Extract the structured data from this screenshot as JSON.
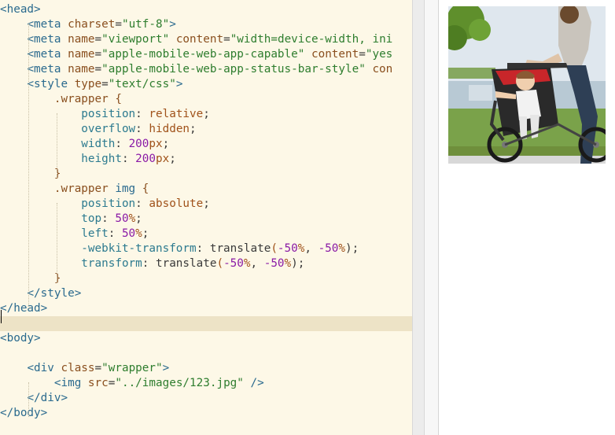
{
  "editor": {
    "lines": [
      [
        [
          "c-tag",
          "<head>"
        ]
      ],
      [
        [
          "c-txt",
          "    "
        ],
        [
          "c-tag",
          "<meta "
        ],
        [
          "c-attr",
          "charset"
        ],
        [
          "c-txt",
          "="
        ],
        [
          "c-val",
          "\"utf-8\""
        ],
        [
          "c-tag",
          ">"
        ]
      ],
      [
        [
          "c-txt",
          "    "
        ],
        [
          "c-tag",
          "<meta "
        ],
        [
          "c-attr",
          "name"
        ],
        [
          "c-txt",
          "="
        ],
        [
          "c-val",
          "\"viewport\""
        ],
        [
          "c-txt",
          " "
        ],
        [
          "c-attr",
          "content"
        ],
        [
          "c-txt",
          "="
        ],
        [
          "c-val",
          "\"width=device-width, ini"
        ]
      ],
      [
        [
          "c-txt",
          "    "
        ],
        [
          "c-tag",
          "<meta "
        ],
        [
          "c-attr",
          "name"
        ],
        [
          "c-txt",
          "="
        ],
        [
          "c-val",
          "\"apple-mobile-web-app-capable\""
        ],
        [
          "c-txt",
          " "
        ],
        [
          "c-attr",
          "content"
        ],
        [
          "c-txt",
          "="
        ],
        [
          "c-val",
          "\"yes"
        ]
      ],
      [
        [
          "c-txt",
          "    "
        ],
        [
          "c-tag",
          "<meta "
        ],
        [
          "c-attr",
          "name"
        ],
        [
          "c-txt",
          "="
        ],
        [
          "c-val",
          "\"apple-mobile-web-app-status-bar-style\""
        ],
        [
          "c-txt",
          " "
        ],
        [
          "c-attr",
          "con"
        ]
      ],
      [
        [
          "c-txt",
          "    "
        ],
        [
          "c-tag",
          "<style "
        ],
        [
          "c-attr",
          "type"
        ],
        [
          "c-txt",
          "="
        ],
        [
          "c-val",
          "\"text/css\""
        ],
        [
          "c-tag",
          ">"
        ]
      ],
      [
        [
          "c-txt",
          "        "
        ],
        [
          "c-sel",
          ".wrapper {"
        ]
      ],
      [
        [
          "c-txt",
          "            "
        ],
        [
          "c-prop",
          "position"
        ],
        [
          "c-txt",
          ": "
        ],
        [
          "c-pval",
          "relative"
        ],
        [
          "c-txt",
          ";"
        ]
      ],
      [
        [
          "c-txt",
          "            "
        ],
        [
          "c-prop",
          "overflow"
        ],
        [
          "c-txt",
          ": "
        ],
        [
          "c-pval",
          "hidden"
        ],
        [
          "c-txt",
          ";"
        ]
      ],
      [
        [
          "c-txt",
          "            "
        ],
        [
          "c-prop",
          "width"
        ],
        [
          "c-txt",
          ": "
        ],
        [
          "c-num",
          "200"
        ],
        [
          "c-pval",
          "px"
        ],
        [
          "c-txt",
          ";"
        ]
      ],
      [
        [
          "c-txt",
          "            "
        ],
        [
          "c-prop",
          "height"
        ],
        [
          "c-txt",
          ": "
        ],
        [
          "c-num",
          "200"
        ],
        [
          "c-pval",
          "px"
        ],
        [
          "c-txt",
          ";"
        ]
      ],
      [
        [
          "c-txt",
          "        "
        ],
        [
          "c-sel",
          "}"
        ]
      ],
      [
        [
          "c-txt",
          "        "
        ],
        [
          "c-sel",
          ".wrapper "
        ],
        [
          "c-tag",
          "img"
        ],
        [
          "c-sel",
          " {"
        ]
      ],
      [
        [
          "c-txt",
          "            "
        ],
        [
          "c-prop",
          "position"
        ],
        [
          "c-txt",
          ": "
        ],
        [
          "c-pval",
          "absolute"
        ],
        [
          "c-txt",
          ";"
        ]
      ],
      [
        [
          "c-txt",
          "            "
        ],
        [
          "c-prop",
          "top"
        ],
        [
          "c-txt",
          ": "
        ],
        [
          "c-num",
          "50"
        ],
        [
          "c-pval",
          "%"
        ],
        [
          "c-txt",
          ";"
        ]
      ],
      [
        [
          "c-txt",
          "            "
        ],
        [
          "c-prop",
          "left"
        ],
        [
          "c-txt",
          ": "
        ],
        [
          "c-num",
          "50"
        ],
        [
          "c-pval",
          "%"
        ],
        [
          "c-txt",
          ";"
        ]
      ],
      [
        [
          "c-txt",
          "            "
        ],
        [
          "c-prop",
          "-webkit-transform"
        ],
        [
          "c-txt",
          ": "
        ],
        [
          "c-func",
          "translate"
        ],
        [
          "c-pval",
          "("
        ],
        [
          "c-num",
          "-50"
        ],
        [
          "c-pval",
          "%"
        ],
        [
          "c-txt",
          ", "
        ],
        [
          "c-num",
          "-50"
        ],
        [
          "c-pval",
          "%"
        ],
        [
          "c-txt",
          ");"
        ]
      ],
      [
        [
          "c-txt",
          "            "
        ],
        [
          "c-prop",
          "transform"
        ],
        [
          "c-txt",
          ": "
        ],
        [
          "c-func",
          "translate"
        ],
        [
          "c-pval",
          "("
        ],
        [
          "c-num",
          "-50"
        ],
        [
          "c-pval",
          "%"
        ],
        [
          "c-txt",
          ", "
        ],
        [
          "c-num",
          "-50"
        ],
        [
          "c-pval",
          "%"
        ],
        [
          "c-txt",
          ");"
        ]
      ],
      [
        [
          "c-txt",
          "        "
        ],
        [
          "c-sel",
          "}"
        ]
      ],
      [
        [
          "c-txt",
          "    "
        ],
        [
          "c-tag",
          "</style>"
        ]
      ],
      [
        [
          "c-tag",
          "</head>"
        ]
      ],
      [],
      [
        [
          "c-tag",
          "<body>"
        ]
      ],
      [],
      [
        [
          "c-txt",
          "    "
        ],
        [
          "c-tag",
          "<div "
        ],
        [
          "c-attr",
          "class"
        ],
        [
          "c-txt",
          "="
        ],
        [
          "c-val",
          "\"wrapper\""
        ],
        [
          "c-tag",
          ">"
        ]
      ],
      [
        [
          "c-txt",
          "        "
        ],
        [
          "c-tag",
          "<img "
        ],
        [
          "c-attr",
          "src"
        ],
        [
          "c-txt",
          "="
        ],
        [
          "c-val",
          "\"../images/123.jpg\""
        ],
        [
          "c-txt",
          " "
        ],
        [
          "c-tag",
          "/>"
        ]
      ],
      [
        [
          "c-txt",
          "    "
        ],
        [
          "c-tag",
          "</div>"
        ]
      ],
      [
        [
          "c-tag",
          "</body>"
        ]
      ]
    ],
    "current_line": 21
  },
  "preview": {
    "image_icon": "photo-mother-child-stroller-icon"
  }
}
